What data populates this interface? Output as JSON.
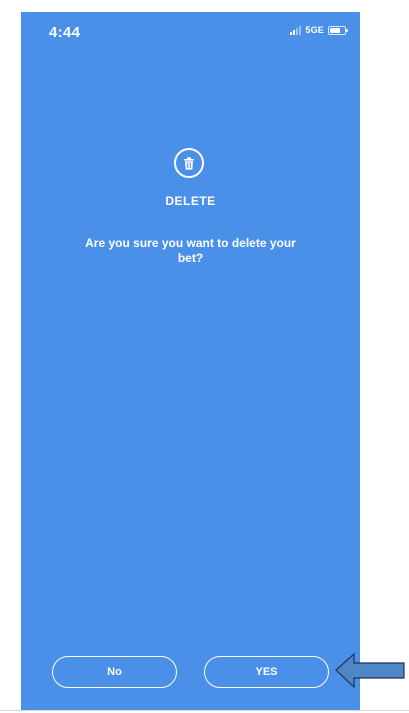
{
  "status_bar": {
    "time": "4:44",
    "network": "5GE"
  },
  "dialog": {
    "icon": "trash-icon",
    "title": "DELETE",
    "message": "Are you sure you want to delete your bet?"
  },
  "buttons": {
    "no_label": "No",
    "yes_label": "YES"
  },
  "annotation": {
    "arrow_icon": "left-arrow-icon",
    "arrow_color": "#4f86c6"
  },
  "colors": {
    "background": "#4a90e8",
    "text": "#ffffff"
  }
}
